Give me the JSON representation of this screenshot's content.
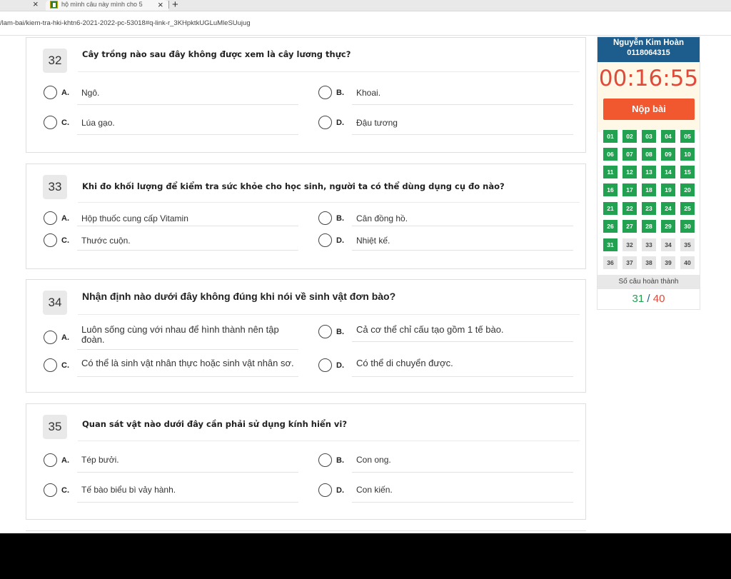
{
  "browser": {
    "prev_tab_close": "×",
    "tab_title": "hộ mình câu này mình cho 5",
    "tab_close": "×",
    "new_tab": "+",
    "url": "/lam-bai/kiem-tra-hki-khtn6-2021-2022-pc-53018#q-link-r_3KHpktkUGLuMleSUujug"
  },
  "questions": [
    {
      "number": "32",
      "text": "Cây trồng nào sau đây không được xem là cây lương thực?",
      "options": [
        {
          "letter": "A.",
          "text": "Ngô."
        },
        {
          "letter": "B.",
          "text": "Khoai."
        },
        {
          "letter": "C.",
          "text": "Lúa gạo."
        },
        {
          "letter": "D.",
          "text": "Đậu tương"
        }
      ]
    },
    {
      "number": "33",
      "text": "Khi đo khối lượng để kiểm tra sức khỏe cho học sinh, người ta có thể dùng dụng cụ đo nào?",
      "options": [
        {
          "letter": "A.",
          "text": "Hộp thuốc cung cấp Vitamin"
        },
        {
          "letter": "B.",
          "text": "Cân đồng hồ."
        },
        {
          "letter": "C.",
          "text": "Thước cuộn."
        },
        {
          "letter": "D.",
          "text": "Nhiệt kế."
        }
      ]
    },
    {
      "number": "34",
      "text": "Nhận định nào dưới đây không đúng khi nói về sinh vật đơn bào?",
      "options": [
        {
          "letter": "A.",
          "text": "Luôn sống cùng với nhau để hình thành nên tập đoàn."
        },
        {
          "letter": "B.",
          "text": "Cả cơ thể chỉ cấu tạo gồm 1 tế bào."
        },
        {
          "letter": "C.",
          "text": "Có thể là sinh vật nhân thực hoặc sinh vật nhân sơ."
        },
        {
          "letter": "D.",
          "text": "Có thể di chuyển được."
        }
      ]
    },
    {
      "number": "35",
      "text": "Quan sát vật nào dưới đây cần phải sử dụng kính hiển vi?",
      "options": [
        {
          "letter": "A.",
          "text": "Tép bưởi."
        },
        {
          "letter": "B.",
          "text": "Con ong."
        },
        {
          "letter": "C.",
          "text": "Tế bào biểu bì vảy hành."
        },
        {
          "letter": "D.",
          "text": "Con kiến."
        }
      ]
    }
  ],
  "sidebar": {
    "student_name": "Nguyễn Kim Hoàn",
    "student_id": "0118064315",
    "timer": "00:16:55",
    "submit_label": "Nộp bài",
    "question_cells": [
      {
        "label": "01",
        "done": true
      },
      {
        "label": "02",
        "done": true
      },
      {
        "label": "03",
        "done": true
      },
      {
        "label": "04",
        "done": true
      },
      {
        "label": "05",
        "done": true
      },
      {
        "label": "06",
        "done": true
      },
      {
        "label": "07",
        "done": true
      },
      {
        "label": "08",
        "done": true
      },
      {
        "label": "09",
        "done": true
      },
      {
        "label": "10",
        "done": true
      },
      {
        "label": "11",
        "done": true
      },
      {
        "label": "12",
        "done": true
      },
      {
        "label": "13",
        "done": true
      },
      {
        "label": "14",
        "done": true
      },
      {
        "label": "15",
        "done": true
      },
      {
        "label": "16",
        "done": true
      },
      {
        "label": "17",
        "done": true
      },
      {
        "label": "18",
        "done": true
      },
      {
        "label": "19",
        "done": true
      },
      {
        "label": "20",
        "done": true
      },
      {
        "label": "21",
        "done": true
      },
      {
        "label": "22",
        "done": true
      },
      {
        "label": "23",
        "done": true
      },
      {
        "label": "24",
        "done": true
      },
      {
        "label": "25",
        "done": true
      },
      {
        "label": "26",
        "done": true
      },
      {
        "label": "27",
        "done": true
      },
      {
        "label": "28",
        "done": true
      },
      {
        "label": "29",
        "done": true
      },
      {
        "label": "30",
        "done": true
      },
      {
        "label": "31",
        "done": true
      },
      {
        "label": "32",
        "done": false
      },
      {
        "label": "33",
        "done": false
      },
      {
        "label": "34",
        "done": false
      },
      {
        "label": "35",
        "done": false
      },
      {
        "label": "36",
        "done": false
      },
      {
        "label": "37",
        "done": false
      },
      {
        "label": "38",
        "done": false
      },
      {
        "label": "39",
        "done": false
      },
      {
        "label": "40",
        "done": false
      }
    ],
    "completed_label": "Số câu hoàn thành",
    "completed": "31",
    "separator": "/",
    "total": "40"
  },
  "colors": {
    "header_blue": "#1c5d8d",
    "timer_red": "#e04a3a",
    "submit_orange": "#f1582f",
    "done_green": "#22a150"
  }
}
